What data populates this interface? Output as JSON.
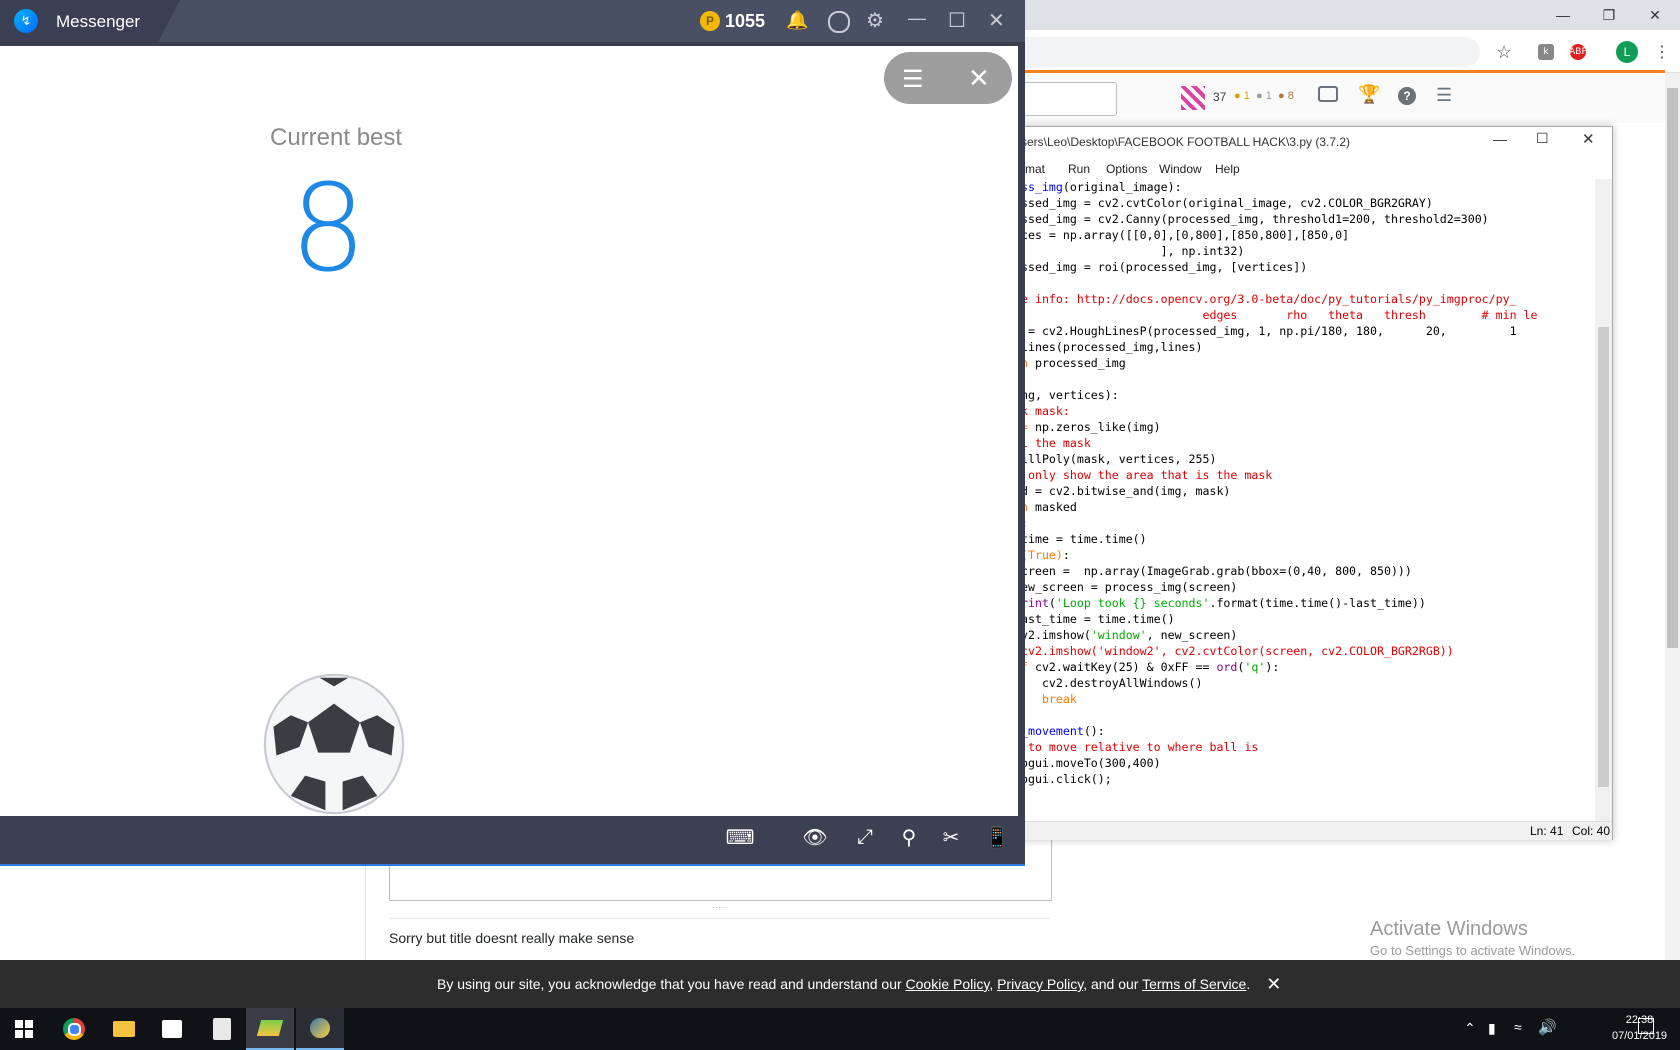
{
  "messenger": {
    "title": "Messenger",
    "coins": "1055"
  },
  "game": {
    "current_best_label": "Current best",
    "current_best_value": "8"
  },
  "idle": {
    "title": "sers\\Leo\\Desktop\\FACEBOOK FOOTBALL HACK\\3.py (3.7.2)",
    "menu": [
      "rmat",
      "Run",
      "Options",
      "Window",
      "Help"
    ],
    "status_ln": "Ln: 41",
    "status_col": "Col: 40"
  },
  "stackoverflow": {
    "rep": "37",
    "gold": "1",
    "silver": "1",
    "bronze": "8",
    "comment": "Sorry but title doesnt really make sense"
  },
  "activate": {
    "line1": "Activate Windows",
    "line2": "Go to Settings to activate Windows."
  },
  "cookie": {
    "prefix": "By using our site, you acknowledge that you have read and understand our ",
    "cookie_policy": "Cookie Policy",
    "sep1": ", ",
    "privacy_policy": "Privacy Policy",
    "sep2": ", and our ",
    "terms": "Terms of Service",
    "suffix": "."
  },
  "taskbar": {
    "time": "22:38",
    "date": "07/01/2019"
  },
  "chrome": {
    "avatar_letter": "L"
  },
  "colors": {
    "score_blue": "#1e88e5",
    "bluestacks_bar": "#4a5064",
    "so_orange": "#f48024"
  }
}
